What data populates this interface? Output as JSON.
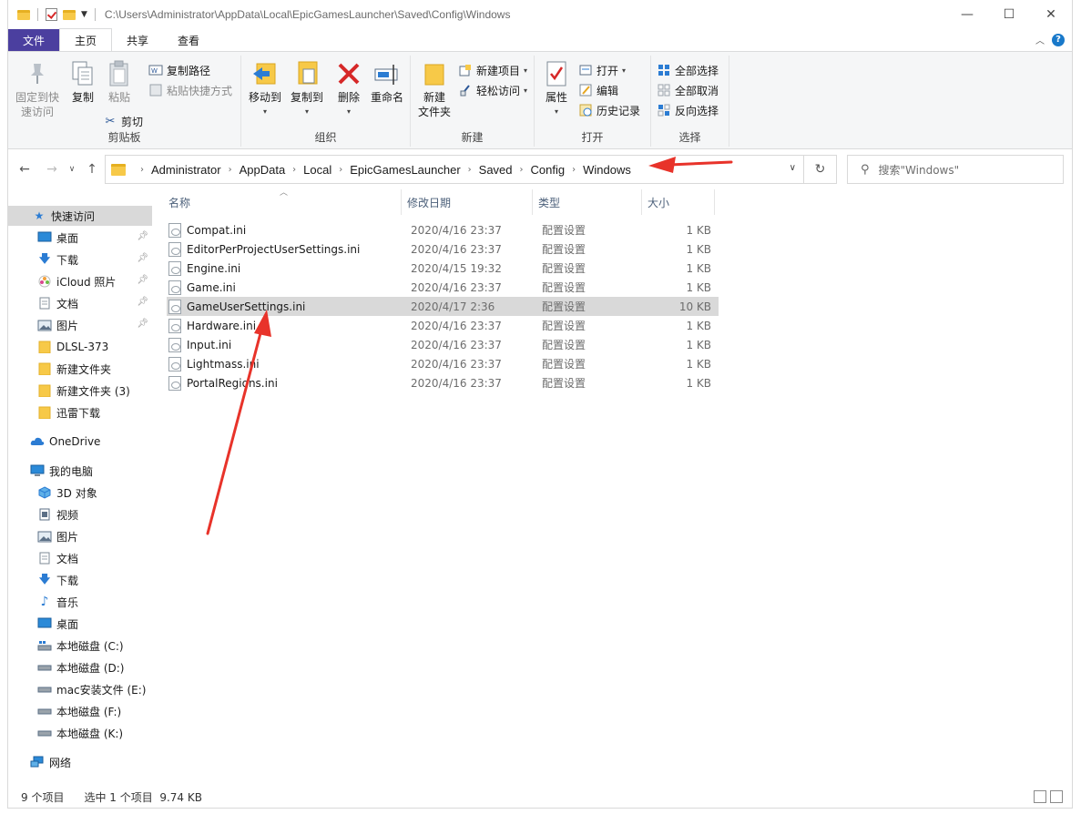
{
  "window": {
    "title_path": "C:\\Users\\Administrator\\AppData\\Local\\EpicGamesLauncher\\Saved\\Config\\Windows",
    "controls": {
      "minimize": "—",
      "maximize": "☐",
      "close": "✕"
    }
  },
  "tabs": [
    {
      "label": "文件"
    },
    {
      "label": "主页"
    },
    {
      "label": "共享"
    },
    {
      "label": "查看"
    }
  ],
  "ribbon": {
    "clipboard": {
      "label": "剪贴板",
      "pin_quick": "固定到快\n速访问",
      "pin_quick_1": "固定到快",
      "pin_quick_2": "速访问",
      "copy": "复制",
      "paste": "粘贴",
      "copy_path": "复制路径",
      "paste_shortcut": "粘贴快捷方式",
      "cut": "剪切"
    },
    "organize": {
      "label": "组织",
      "move_to": "移动到",
      "copy_to": "复制到",
      "delete": "删除",
      "rename": "重命名"
    },
    "new": {
      "label": "新建",
      "new_folder_1": "新建",
      "new_folder_2": "文件夹",
      "new_item": "新建项目",
      "easy_access": "轻松访问"
    },
    "open": {
      "label": "打开",
      "properties": "属性",
      "open": "打开",
      "edit": "编辑",
      "history": "历史记录"
    },
    "select": {
      "label": "选择",
      "select_all": "全部选择",
      "select_none": "全部取消",
      "invert": "反向选择"
    }
  },
  "address": {
    "crumbs": [
      "Administrator",
      "AppData",
      "Local",
      "EpicGamesLauncher",
      "Saved",
      "Config",
      "Windows"
    ],
    "search_placeholder": "搜索\"Windows\""
  },
  "nav": {
    "quick_access": "快速访问",
    "pinned": [
      "桌面",
      "下载",
      "iCloud 照片",
      "文档",
      "图片"
    ],
    "folders": [
      "DLSL-373",
      "新建文件夹",
      "新建文件夹 (3)",
      "迅雷下载"
    ],
    "onedrive": "OneDrive",
    "this_pc": "我的电脑",
    "pc_items": [
      "3D 对象",
      "视频",
      "图片",
      "文档",
      "下载",
      "音乐",
      "桌面"
    ],
    "drives": [
      "本地磁盘 (C:)",
      "本地磁盘 (D:)",
      "mac安装文件 (E:)",
      "本地磁盘 (F:)",
      "本地磁盘 (K:)"
    ],
    "network": "网络"
  },
  "columns": {
    "name": "名称",
    "date": "修改日期",
    "type": "类型",
    "size": "大小"
  },
  "files": [
    {
      "name": "Compat.ini",
      "date": "2020/4/16 23:37",
      "type": "配置设置",
      "size": "1 KB"
    },
    {
      "name": "EditorPerProjectUserSettings.ini",
      "date": "2020/4/16 23:37",
      "type": "配置设置",
      "size": "1 KB"
    },
    {
      "name": "Engine.ini",
      "date": "2020/4/15 19:32",
      "type": "配置设置",
      "size": "1 KB"
    },
    {
      "name": "Game.ini",
      "date": "2020/4/16 23:37",
      "type": "配置设置",
      "size": "1 KB"
    },
    {
      "name": "GameUserSettings.ini",
      "date": "2020/4/17 2:36",
      "type": "配置设置",
      "size": "10 KB"
    },
    {
      "name": "Hardware.ini",
      "date": "2020/4/16 23:37",
      "type": "配置设置",
      "size": "1 KB"
    },
    {
      "name": "Input.ini",
      "date": "2020/4/16 23:37",
      "type": "配置设置",
      "size": "1 KB"
    },
    {
      "name": "Lightmass.ini",
      "date": "2020/4/16 23:37",
      "type": "配置设置",
      "size": "1 KB"
    },
    {
      "name": "PortalRegions.ini",
      "date": "2020/4/16 23:37",
      "type": "配置设置",
      "size": "1 KB"
    }
  ],
  "status": {
    "count": "9 个项目",
    "selection": "选中 1 个项目  9.74 KB"
  },
  "colors": {
    "accent_file_tab": "#4b3f9f",
    "annotation_red": "#e8332a",
    "selection_gray": "#d9d9d9"
  }
}
